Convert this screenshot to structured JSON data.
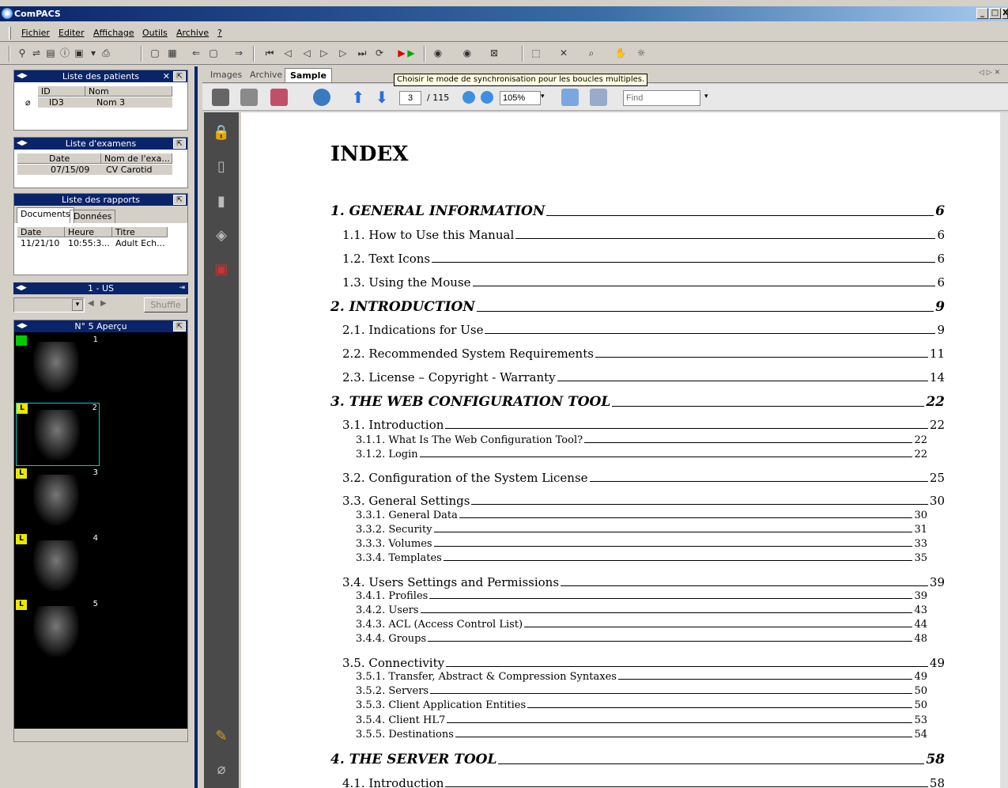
{
  "app": {
    "title": "ComPACS",
    "win_min": "_",
    "win_max": "□",
    "win_close": "X"
  },
  "menu": [
    "Fichier",
    "Editer",
    "Affichage",
    "Outils",
    "Archive",
    "?"
  ],
  "patients": {
    "title": "Liste des patients",
    "cols": [
      "ID",
      "Nom"
    ],
    "row": {
      "id": "ID3",
      "nom": "Nom 3"
    }
  },
  "exams": {
    "title": "Liste d'examens",
    "cols": [
      "Date",
      "Nom de l'exa..."
    ],
    "row": {
      "date": "07/15/09",
      "nom": "CV Carotid"
    }
  },
  "reports": {
    "title": "Liste des rapports",
    "tabs": [
      "Documents",
      "Données"
    ],
    "cols": [
      "Date",
      "Heure",
      "Titre"
    ],
    "row": {
      "date": "11/21/10",
      "heure": "10:55:3...",
      "titre": "Adult Ech..."
    }
  },
  "series": {
    "title": "1 - US",
    "shuffle": "Shuffle"
  },
  "preview": {
    "title": "N° 5 Aperçu",
    "thumbs": [
      {
        "label": "",
        "num": "1"
      },
      {
        "label": "L",
        "num": "2"
      },
      {
        "label": "L",
        "num": "3"
      },
      {
        "label": "L",
        "num": "4"
      },
      {
        "label": "L",
        "num": "5"
      }
    ]
  },
  "viewer_tabs": [
    "Images",
    "Archive",
    "Sample"
  ],
  "tooltip": "Choisir le mode de synchronisation pour les boucles multiples.",
  "pdf": {
    "page": "3",
    "total": "/ 115",
    "zoom": "105%",
    "find_placeholder": "Find"
  },
  "doc": {
    "heading": "INDEX",
    "entries": [
      {
        "lvl": 1,
        "t": "1. GENERAL INFORMATION",
        "p": "6"
      },
      {
        "lvl": 2,
        "t": "1.1. How to Use this Manual",
        "p": "6"
      },
      {
        "lvl": 2,
        "t": "1.2. Text Icons",
        "p": "6"
      },
      {
        "lvl": 2,
        "t": "1.3. Using the Mouse",
        "p": "6"
      },
      {
        "lvl": 1,
        "t": "2. INTRODUCTION",
        "p": "9"
      },
      {
        "lvl": 2,
        "t": "2.1. Indications for Use",
        "p": "9"
      },
      {
        "lvl": 2,
        "t": "2.2. Recommended System Requirements",
        "p": "11"
      },
      {
        "lvl": 2,
        "t": "2.3. License – Copyright - Warranty",
        "p": "14"
      },
      {
        "lvl": 1,
        "t": "3. THE WEB CONFIGURATION TOOL",
        "p": "22"
      },
      {
        "lvl": 2,
        "t": "3.1. Introduction",
        "p": "22"
      },
      {
        "lvl": 3,
        "t": "3.1.1. What Is The Web Configuration Tool?",
        "p": "22"
      },
      {
        "lvl": 3,
        "t": "3.1.2. Login",
        "p": "22"
      },
      {
        "lvl": 2,
        "t": "3.2. Configuration of the System License",
        "p": "25"
      },
      {
        "lvl": 2,
        "t": "3.3. General Settings",
        "p": "30"
      },
      {
        "lvl": 3,
        "t": "3.3.1. General Data",
        "p": "30"
      },
      {
        "lvl": 3,
        "t": "3.3.2. Security",
        "p": "31"
      },
      {
        "lvl": 3,
        "t": "3.3.3. Volumes",
        "p": "33"
      },
      {
        "lvl": 3,
        "t": "3.3.4. Templates",
        "p": "35"
      },
      {
        "lvl": 2,
        "t": "3.4. Users Settings and Permissions",
        "p": "39"
      },
      {
        "lvl": 3,
        "t": "3.4.1. Profiles",
        "p": "39"
      },
      {
        "lvl": 3,
        "t": "3.4.2. Users",
        "p": "43"
      },
      {
        "lvl": 3,
        "t": "3.4.3. ACL (Access Control List)",
        "p": "44"
      },
      {
        "lvl": 3,
        "t": "3.4.4. Groups",
        "p": "48"
      },
      {
        "lvl": 2,
        "t": "3.5. Connectivity",
        "p": "49"
      },
      {
        "lvl": 3,
        "t": "3.5.1. Transfer, Abstract & Compression Syntaxes",
        "p": "49"
      },
      {
        "lvl": 3,
        "t": "3.5.2. Servers",
        "p": "50"
      },
      {
        "lvl": 3,
        "t": "3.5.3. Client Application Entities",
        "p": "50"
      },
      {
        "lvl": 3,
        "t": "3.5.4. Client HL7",
        "p": "53"
      },
      {
        "lvl": 3,
        "t": "3.5.5. Destinations",
        "p": "54"
      },
      {
        "lvl": 1,
        "t": "4. THE SERVER TOOL",
        "p": "58"
      },
      {
        "lvl": 2,
        "t": "4.1. Introduction",
        "p": "58"
      }
    ]
  }
}
